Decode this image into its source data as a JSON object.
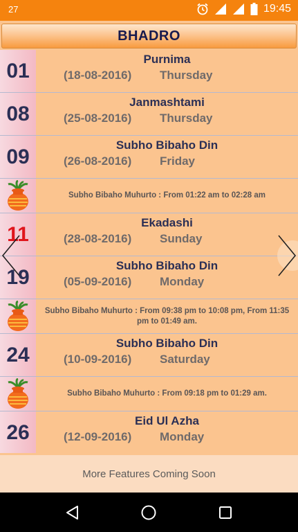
{
  "status_bar": {
    "left_text": "27",
    "time": "19:45"
  },
  "header": {
    "title": "BHADRO"
  },
  "entries": [
    {
      "kind": "event",
      "day": "01",
      "title": "Purnima",
      "date": "(18-08-2016)",
      "weekday": "Thursday",
      "holiday": false
    },
    {
      "kind": "event",
      "day": "08",
      "title": "Janmashtami",
      "date": "(25-08-2016)",
      "weekday": "Thursday",
      "holiday": false
    },
    {
      "kind": "event",
      "day": "09",
      "title": "Subho Bibaho Din",
      "date": "(26-08-2016)",
      "weekday": "Friday",
      "holiday": false
    },
    {
      "kind": "muhurto",
      "text": "Subho Bibaho Muhurto : From 01:22 am to 02:28 am"
    },
    {
      "kind": "event",
      "day": "11",
      "title": "Ekadashi",
      "date": "(28-08-2016)",
      "weekday": "Sunday",
      "holiday": true
    },
    {
      "kind": "event",
      "day": "19",
      "title": "Subho Bibaho Din",
      "date": "(05-09-2016)",
      "weekday": "Monday",
      "holiday": false
    },
    {
      "kind": "muhurto",
      "text": "Subho Bibaho Muhurto : From 09:38 pm to 10:08 pm, From 11:35 pm to 01:49 am."
    },
    {
      "kind": "event",
      "day": "24",
      "title": "Subho Bibaho Din",
      "date": "(10-09-2016)",
      "weekday": "Saturday",
      "holiday": false
    },
    {
      "kind": "muhurto",
      "text": "Subho Bibaho Muhurto : From 09:18 pm to 01:29 am."
    },
    {
      "kind": "event",
      "day": "26",
      "title": "Eid Ul Azha",
      "date": "(12-09-2016)",
      "weekday": "Monday",
      "holiday": false
    }
  ],
  "footer": {
    "text": "More Features Coming Soon"
  },
  "icons": {
    "alarm": "alarm-icon",
    "signal": "signal-icon",
    "battery": "battery-icon",
    "prev": "chevron-left-icon",
    "next": "chevron-right-icon",
    "back": "back-icon",
    "home": "home-icon",
    "recents": "recents-icon",
    "kalash": "kalash-icon"
  },
  "colors": {
    "status_bar": "#f5830e",
    "background": "#fbc48f",
    "holiday": "#e0151c",
    "date_column": "#f3b9c4"
  }
}
